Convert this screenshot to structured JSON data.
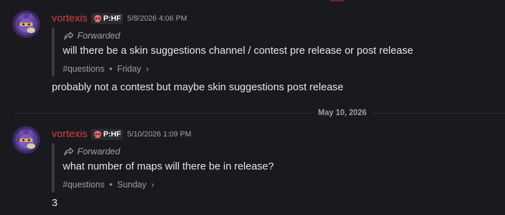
{
  "messages": [
    {
      "username": "vortexis",
      "tag": "P:HF",
      "timestamp": "5/8/2026 4:06 PM",
      "forward_label": "Forwarded",
      "forward_text": "will there be a skin suggestions channel / contest pre release or post release",
      "channel": "#questions",
      "day": "Friday",
      "reply": "probably not a contest but maybe skin suggestions post release"
    },
    {
      "username": "vortexis",
      "tag": "P:HF",
      "timestamp": "5/10/2026 1:09 PM",
      "forward_label": "Forwarded",
      "forward_text": "what number of maps will there be in release?",
      "channel": "#questions",
      "day": "Sunday",
      "reply": "3"
    }
  ],
  "date_divider": "May 10, 2026",
  "colors": {
    "background": "#1a1a1e",
    "username": "#e03b3b",
    "text": "#e6e6ea",
    "muted": "#a1a1aa"
  },
  "icons": [
    "avatar-image",
    "skull-tag-icon",
    "forward-arrow-icon",
    "chevron-right-icon"
  ]
}
